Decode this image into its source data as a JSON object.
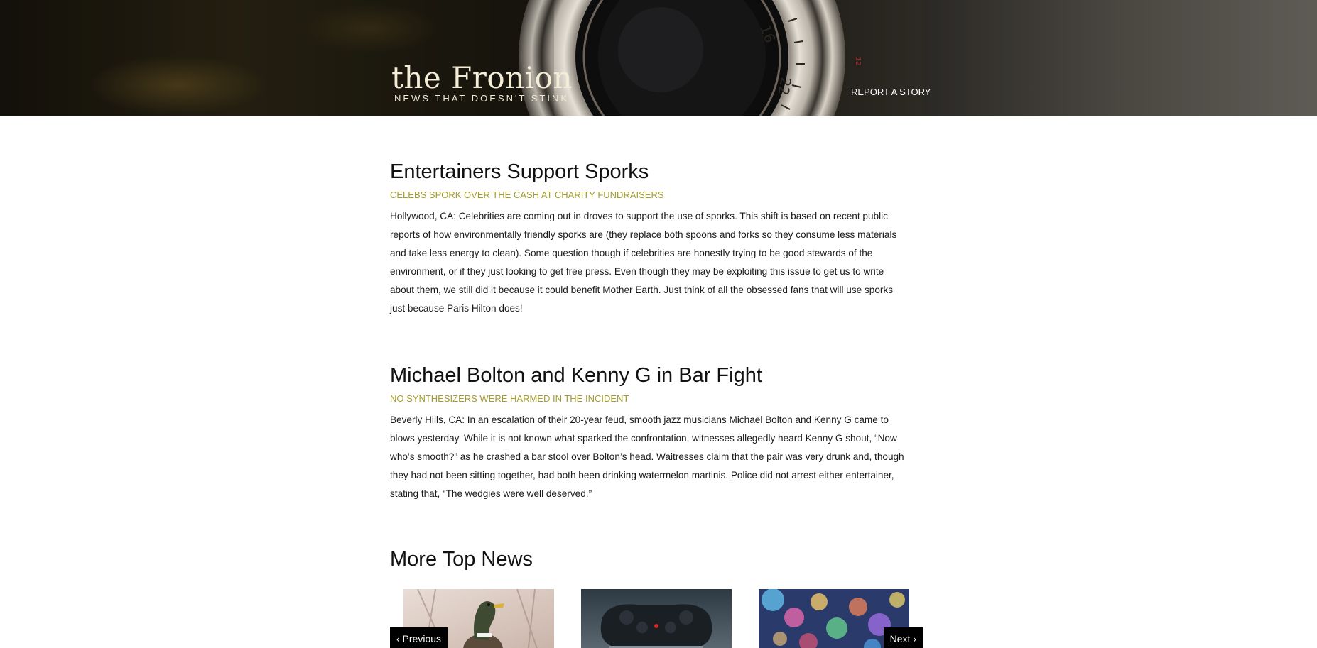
{
  "header": {
    "logo_title": "the Fronion",
    "logo_tagline": "NEWS THAT DOESN'T STINK",
    "nav_report": "REPORT A STORY",
    "lens_numbers": [
      "16",
      "22",
      "12"
    ]
  },
  "articles": [
    {
      "title": "Entertainers Support Sporks",
      "subhead": "CELEBS SPORK OVER THE CASH AT CHARITY FUNDRAISERS",
      "lines": [
        "Hollywood, CA: Celebrities are coming out in droves to support the use of sporks. This shift is based on recent public",
        "reports of how environmentally friendly sporks are (they replace both spoons and forks so they consume less materials",
        "and take less energy to clean). Some question though if celebrities are honestly trying to be good stewards of the",
        "environment, or if they just looking to get free press. Even though they may be exploiting this issue to get us to write",
        "about them, we still did it because it could benefit Mother Earth. Just think of all the obsessed fans that will use sporks",
        "just because Paris Hilton does!"
      ]
    },
    {
      "title": "Michael Bolton and Kenny G in Bar Fight",
      "subhead": "NO SYNTHESIZERS WERE HARMED IN THE INCIDENT",
      "lines": [
        "Beverly Hills, CA: In an escalation of their 20-year feud, smooth jazz musicians Michael Bolton and Kenny G came to",
        "blows yesterday. While it is not known what sparked the confrontation, witnesses allegedly heard Kenny G shout, “Now",
        "who’s smooth?” as he crashed a bar stool over Bolton’s head. Waitresses claim that the pair was very drunk and, though",
        "they had not been sitting together, had both been drinking watermelon martinis. Police did not arrest either entertainer,",
        "stating that, “The wedgies were well deserved.”"
      ]
    }
  ],
  "more_news": {
    "title": "More Top News",
    "prev_label": "‹ Previous",
    "next_label": "Next ›",
    "thumbnails": [
      {
        "subject": "duck"
      },
      {
        "subject": "game-controller"
      },
      {
        "subject": "bokeh-lights"
      }
    ]
  },
  "colors": {
    "subhead": "#a39c2b",
    "text": "#111111",
    "button_bg": "#000000"
  }
}
